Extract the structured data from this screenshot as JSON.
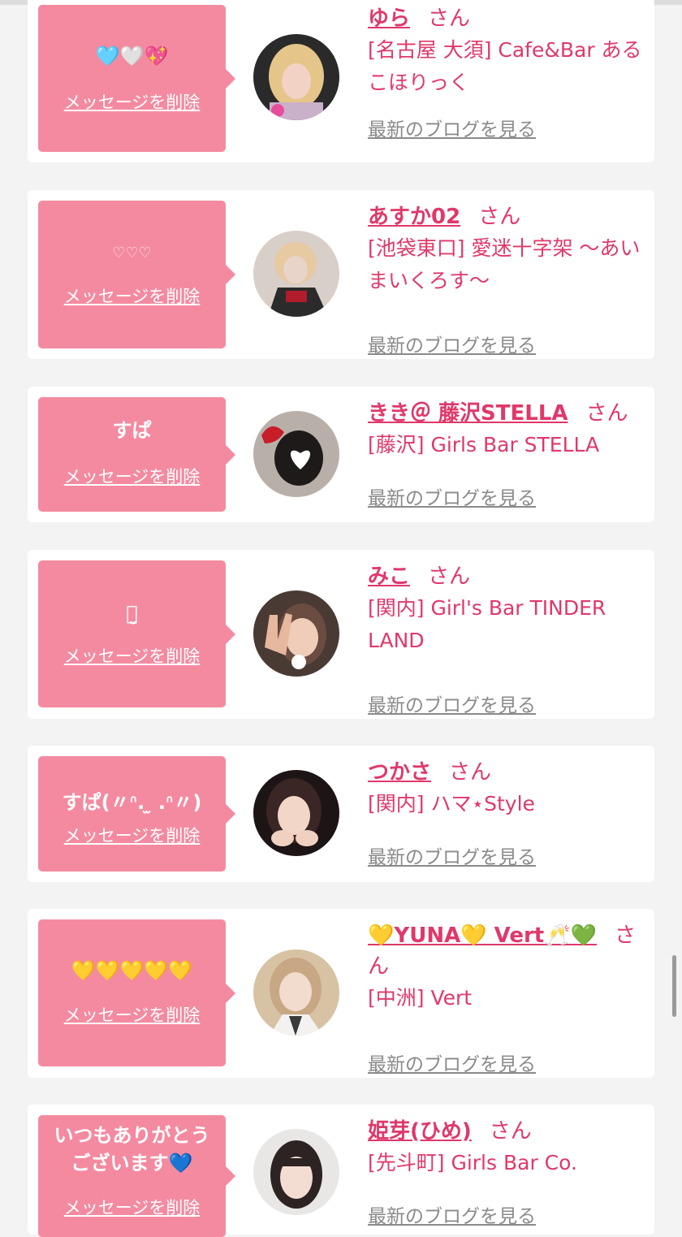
{
  "common": {
    "delete_label": "メッセージを削除",
    "san_label": "さん",
    "blog_label": "最新のブログを見る"
  },
  "cards": [
    {
      "message": "🩵🤍💖",
      "name": "ゆら",
      "shop": "[名古屋 大須] Cafe&Bar あるこほりっく",
      "avatar_icon": "blonde-girl-avatar",
      "avatar_colors": [
        "#2a2a2a",
        "#e6c58a",
        "#f2d2c4"
      ]
    },
    {
      "message": "♡♡♡",
      "name": "あすか02",
      "shop": "[池袋東口] 愛迷十字架 〜あいまいくろす〜",
      "avatar_icon": "gothic-girl-avatar",
      "avatar_colors": [
        "#d9cfc9",
        "#2b2b2b",
        "#e8d4c8"
      ]
    },
    {
      "message": "すぱ",
      "name": "きき＠ 藤沢STELLA",
      "shop": "[藤沢] Girls Bar STELLA",
      "avatar_icon": "heart-face-avatar",
      "avatar_colors": [
        "#b8b0a8",
        "#c81e2a",
        "#ffffff"
      ]
    },
    {
      "message": "ꪔ̤̮",
      "name": "みこ",
      "shop": "[関内] Girl's Bar TINDER LAND",
      "avatar_icon": "peace-sign-avatar",
      "avatar_colors": [
        "#4a3a34",
        "#f0cdb8",
        "#b08066"
      ]
    },
    {
      "message": "すぱ(〃ᐢ. ̫ .ᐢ〃)",
      "name": "つかさ",
      "shop": "[関内] ハマ⋆Style",
      "avatar_icon": "brunette-girl-avatar",
      "avatar_colors": [
        "#1d1416",
        "#3a2624",
        "#f2d6c8"
      ]
    },
    {
      "message": "💛💛💛💛💛",
      "name": "💛YUNA💛 Vert🥂💚",
      "shop": "[中洲] Vert",
      "avatar_icon": "light-hair-girl-avatar",
      "avatar_colors": [
        "#d7c2a4",
        "#f1dccd",
        "#3a3a3a"
      ]
    },
    {
      "message": "いつもありがとう\nございます💙",
      "name": "姫芽(ひめ)",
      "shop": "[先斗町] Girls Bar Co.",
      "avatar_icon": "dark-hair-girl-avatar",
      "avatar_colors": [
        "#e9e7e6",
        "#2c2322",
        "#f3ddd3"
      ]
    }
  ],
  "colors": {
    "accent": "#e0386a",
    "bubble": "#f48aa0",
    "background": "#f3f3f3",
    "card": "#ffffff",
    "link_gray": "#8a8a8a"
  }
}
